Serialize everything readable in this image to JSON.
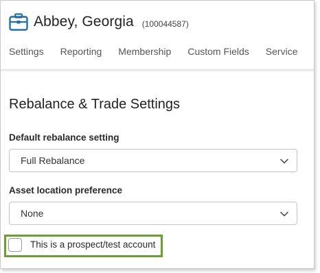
{
  "header": {
    "title": "Abbey, Georgia",
    "account_id": "(100044587)",
    "icon": "briefcase-icon",
    "icon_color": "#1f6fb2"
  },
  "tabs": [
    {
      "label": "Settings"
    },
    {
      "label": "Reporting"
    },
    {
      "label": "Membership"
    },
    {
      "label": "Custom Fields"
    },
    {
      "label": "Service"
    }
  ],
  "section": {
    "title": "Rebalance & Trade Settings"
  },
  "rebalance": {
    "label": "Default rebalance setting",
    "value": "Full Rebalance"
  },
  "asset_location": {
    "label": "Asset location preference",
    "value": "None"
  },
  "prospect": {
    "label": "This is a prospect/test account",
    "checked": false,
    "highlight_color": "#6aa02f"
  }
}
